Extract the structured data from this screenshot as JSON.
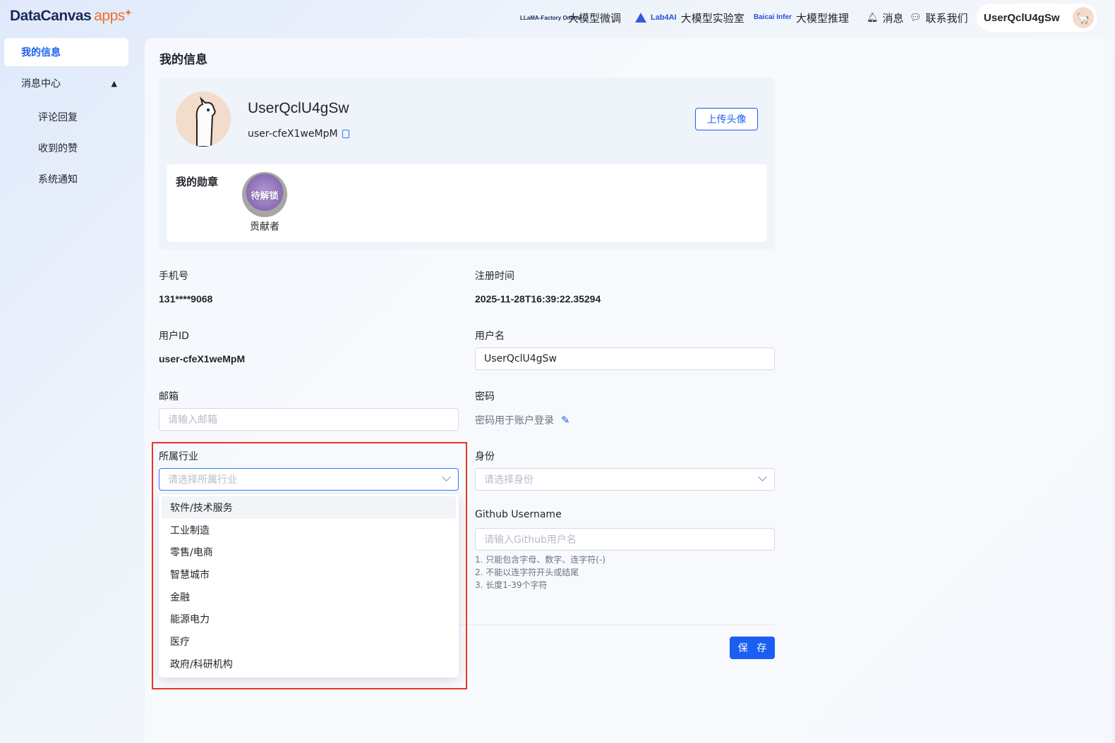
{
  "header": {
    "logo_main": "DataCanvas",
    "logo_apps": "apps",
    "nav": [
      {
        "logo": "LLaMA-Factory Online",
        "label": "大模型微调"
      },
      {
        "logo": "Lab4AI",
        "label": "大模型实验室"
      },
      {
        "logo": "Baicai Infer",
        "label": "大模型推理"
      },
      {
        "label": "消息"
      },
      {
        "label": "联系我们"
      }
    ],
    "user_name": "UserQclU4gSw"
  },
  "sidebar": {
    "active": "我的信息",
    "group": "消息中心",
    "sub_items": [
      "评论回复",
      "收到的赞",
      "系统通知"
    ]
  },
  "main": {
    "title": "我的信息",
    "profile": {
      "username": "UserQclU4gSw",
      "user_id": "user-cfeX1weMpM",
      "upload_label": "上传头像",
      "medals_title": "我的勋章",
      "medal_badge": "待解锁",
      "medal_name": "贡献者"
    },
    "fields": {
      "phone_label": "手机号",
      "phone_value": "131****9068",
      "register_label": "注册时间",
      "register_value": "2025-11-28T16:39:22.35294",
      "userid_label": "用户ID",
      "userid_value": "user-cfeX1weMpM",
      "username_label": "用户名",
      "username_value": "UserQclU4gSw",
      "email_label": "邮箱",
      "email_placeholder": "请输入邮箱",
      "password_label": "密码",
      "password_hint": "密码用于账户登录",
      "industry_label": "所属行业",
      "industry_placeholder": "请选择所属行业",
      "identity_label": "身份",
      "identity_placeholder": "请选择身份",
      "github_label": "Github Username",
      "github_placeholder": "请输入Github用户名",
      "github_rules": [
        "1. 只能包含字母、数字、连字符(-)",
        "2. 不能以连字符开头或结尾",
        "3. 长度1-39个字符"
      ]
    },
    "save_label": "保 存"
  },
  "dropdown": {
    "options": [
      "软件/技术服务",
      "工业制造",
      "零售/电商",
      "智慧城市",
      "金融",
      "能源电力",
      "医疗",
      "政府/科研机构"
    ]
  },
  "colors": {
    "accent": "#1a5ff0",
    "highlight": "#e5352a"
  }
}
